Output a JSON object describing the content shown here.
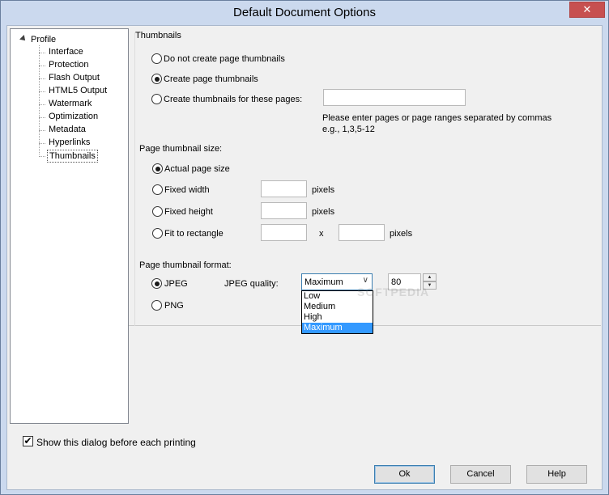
{
  "window": {
    "title": "Default Document Options",
    "close_glyph": "✕"
  },
  "tree": {
    "root": "Profile",
    "items": [
      "Interface",
      "Protection",
      "Flash Output",
      "HTML5 Output",
      "Watermark",
      "Optimization",
      "Metadata",
      "Hyperlinks",
      "Thumbnails"
    ],
    "selected": "Thumbnails"
  },
  "thumbnails": {
    "group_title": "Thumbnails",
    "options": {
      "none": "Do not create page thumbnails",
      "create": "Create page thumbnails",
      "these_pages": "Create thumbnails for these pages:"
    },
    "selected_option": "create",
    "pages_value": "",
    "hint_line1": "Please enter pages or page ranges separated by commas",
    "hint_line2": "e.g., 1,3,5-12"
  },
  "size": {
    "label": "Page thumbnail size:",
    "options": {
      "actual": "Actual page size",
      "fixed_width": "Fixed width",
      "fixed_height": "Fixed height",
      "fit_rect": "Fit to rectangle"
    },
    "selected_option": "actual",
    "fixed_width_value": "",
    "fixed_height_value": "",
    "fit_width_value": "",
    "fit_height_value": "",
    "unit": "pixels",
    "separator": "x"
  },
  "format": {
    "label": "Page thumbnail format:",
    "jpeg": "JPEG",
    "png": "PNG",
    "selected_option": "jpeg",
    "quality_label": "JPEG quality:",
    "quality_selected": "Maximum",
    "quality_options": [
      "Low",
      "Medium",
      "High",
      "Maximum"
    ],
    "quality_value": "80"
  },
  "footer": {
    "show_dialog_label": "Show this dialog before each printing",
    "show_dialog_checked": true,
    "ok": "Ok",
    "cancel": "Cancel",
    "help": "Help"
  },
  "watermark_text": "SOFTPEDIA"
}
